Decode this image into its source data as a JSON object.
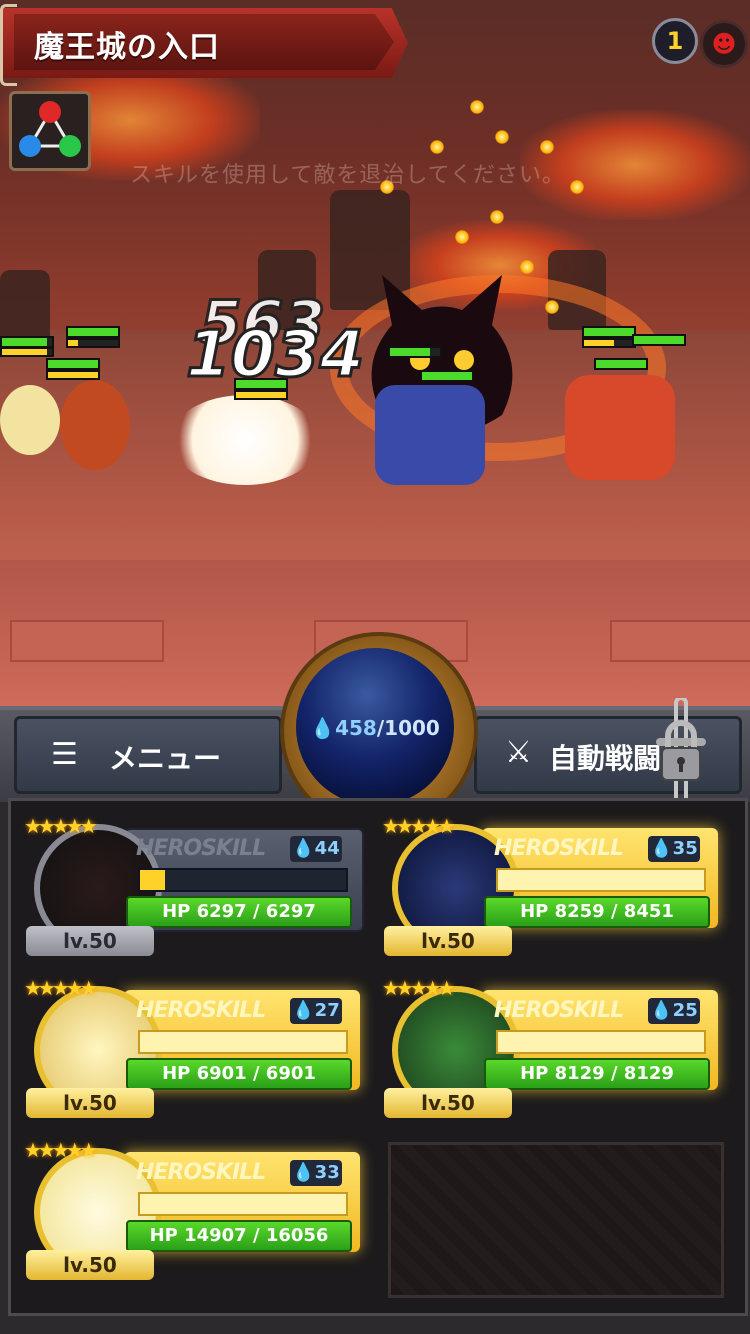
{
  "header": {
    "stage_title": "魔王城の入口",
    "counter": "1",
    "devil_icon": "devil-face-icon"
  },
  "battle": {
    "hint_text": "スキルを使用して敵を退治してください。",
    "damage_numbers": [
      "563",
      "1034"
    ]
  },
  "controls": {
    "menu_label": "メニュー",
    "auto_battle_label": "自動戦闘",
    "mana_current": "458",
    "mana_max": "/1000"
  },
  "heroes": [
    {
      "skill": "HEROSKILL",
      "cost": "44",
      "hp": "HP 6297 / 6297",
      "level": "lv.50",
      "ready": false,
      "gauge": 0.12
    },
    {
      "skill": "HEROSKILL",
      "cost": "35",
      "hp": "HP 8259 / 8451",
      "level": "lv.50",
      "ready": true,
      "gauge": 1
    },
    {
      "skill": "HEROSKILL",
      "cost": "27",
      "hp": "HP 6901 / 6901",
      "level": "lv.50",
      "ready": true,
      "gauge": 1
    },
    {
      "skill": "HEROSKILL",
      "cost": "25",
      "hp": "HP 8129 / 8129",
      "level": "lv.50",
      "ready": true,
      "gauge": 1
    },
    {
      "skill": "HEROSKILL",
      "cost": "33",
      "hp": "HP 14907 / 16056",
      "level": "lv.50",
      "ready": true,
      "gauge": 1
    }
  ],
  "colors": {
    "accent_gold": "#f2b820",
    "hp_green": "#4cdb2a",
    "mana_blue": "#13246a",
    "title_red": "#b8332a"
  }
}
